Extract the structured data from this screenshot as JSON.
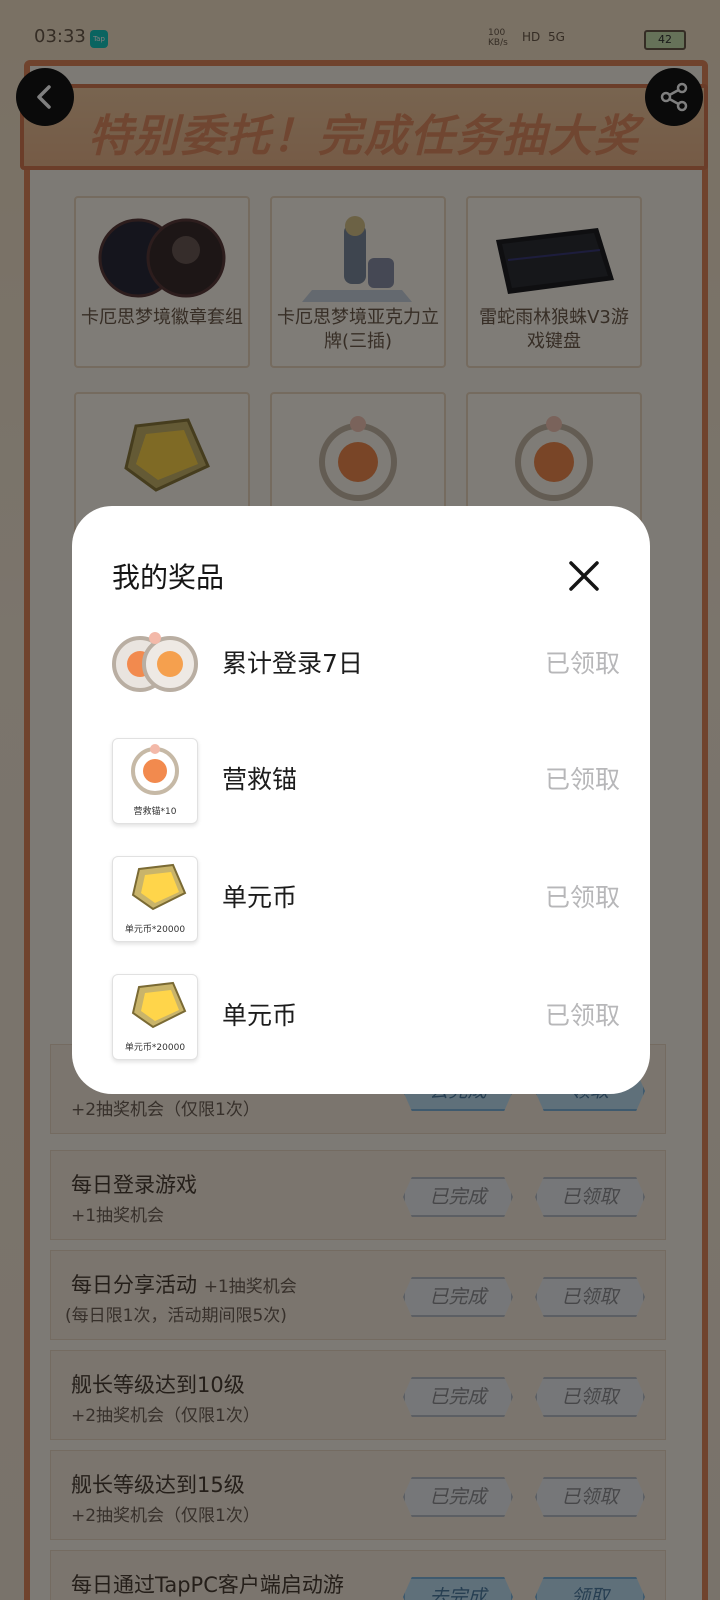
{
  "status_bar": {
    "time": "03:33",
    "app_badge": "Tap",
    "network_speed": "100 KB/s",
    "hd": "HD",
    "signal": "5G",
    "battery": "42"
  },
  "header": {
    "banner_title": "特别委托！完成任务抽大奖",
    "back_icon": "chevron-left-icon",
    "share_icon": "share-icon"
  },
  "prize_grid": [
    {
      "name": "卡厄思梦境徽章套组"
    },
    {
      "name": "卡厄思梦境亚克力立牌(三插)"
    },
    {
      "name": "雷蛇雨林狼蛛V3游戏键盘"
    }
  ],
  "modal": {
    "title": "我的奖品",
    "close_icon": "close-icon",
    "items": [
      {
        "name": "累计登录7日",
        "status": "已领取",
        "thumb_caption": ""
      },
      {
        "name": "营救锚",
        "status": "已领取",
        "thumb_caption": "营救锚*10"
      },
      {
        "name": "单元币",
        "status": "已领取",
        "thumb_caption": "单元币*20000"
      },
      {
        "name": "单元币",
        "status": "已领取",
        "thumb_caption": "单元币*20000"
      }
    ]
  },
  "tasks": [
    {
      "title": "",
      "inline_sub": "",
      "sub": "+2抽奖机会（仅限1次）",
      "btn_a": "去完成",
      "btn_b": "领取"
    },
    {
      "title": "每日登录游戏",
      "inline_sub": "",
      "sub": "+1抽奖机会",
      "btn_a": "已完成",
      "btn_b": "已领取"
    },
    {
      "title": "每日分享活动",
      "inline_sub": "+1抽奖机会",
      "sub": "(每日限1次，活动期间限5次)",
      "btn_a": "已完成",
      "btn_b": "已领取"
    },
    {
      "title": "舰长等级达到10级",
      "inline_sub": "",
      "sub": "+2抽奖机会（仅限1次）",
      "btn_a": "已完成",
      "btn_b": "已领取"
    },
    {
      "title": "舰长等级达到15级",
      "inline_sub": "",
      "sub": "+2抽奖机会（仅限1次）",
      "btn_a": "已完成",
      "btn_b": "已领取"
    },
    {
      "title": "每日通过TapPC客户端启动游",
      "inline_sub": "",
      "sub": "",
      "btn_a": "去完成",
      "btn_b": "领取"
    }
  ],
  "colors": {
    "accent_orange": "#e08d62",
    "overlay": "#000000",
    "status_grey": "#b7b7b9"
  }
}
